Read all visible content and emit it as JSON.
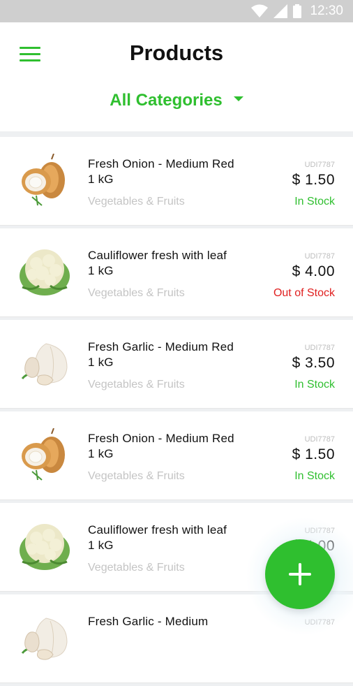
{
  "status_bar": {
    "time": "12:30"
  },
  "header": {
    "title": "Products",
    "category_filter": "All Categories"
  },
  "products": [
    {
      "name": "Fresh Onion - Medium Red  1 kG",
      "category": "Vegetables & Fruits",
      "sku": "UDI7787",
      "price": "$ 1.50",
      "stock": "In Stock",
      "in_stock": true,
      "image": "onion"
    },
    {
      "name": "Cauliflower fresh  with leaf 1 kG",
      "category": "Vegetables & Fruits",
      "sku": "UDI7787",
      "price": "$ 4.00",
      "stock": "Out of Stock",
      "in_stock": false,
      "image": "cauliflower"
    },
    {
      "name": "Fresh Garlic - Medium Red  1 kG",
      "category": "Vegetables & Fruits",
      "sku": "UDI7787",
      "price": "$ 3.50",
      "stock": "In Stock",
      "in_stock": true,
      "image": "garlic"
    },
    {
      "name": "Fresh Onion - Medium Red  1 kG",
      "category": "Vegetables & Fruits",
      "sku": "UDI7787",
      "price": "$ 1.50",
      "stock": "In Stock",
      "in_stock": true,
      "image": "onion"
    },
    {
      "name": "Cauliflower fresh  with leaf 1 kG",
      "category": "Vegetables & Fruits",
      "sku": "UDI7787",
      "price": "$ 4.00",
      "stock": "",
      "in_stock": true,
      "image": "cauliflower"
    },
    {
      "name": "Fresh Garlic - Medium",
      "category": "",
      "sku": "UDI7787",
      "price": "",
      "stock": "",
      "in_stock": true,
      "image": "garlic"
    }
  ],
  "fab": {
    "icon": "plus-icon"
  },
  "colors": {
    "accent": "#2fbf2f",
    "out_of_stock": "#e02020",
    "status_bar": "#cfcfcf"
  }
}
